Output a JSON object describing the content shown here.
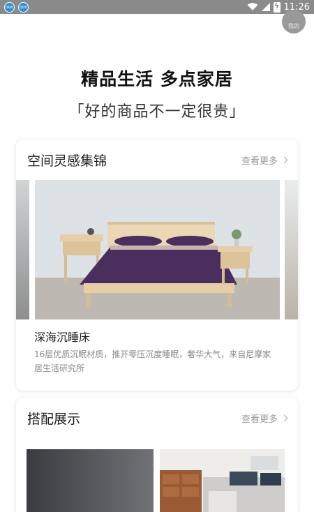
{
  "statusbar": {
    "time": "11:26",
    "apps": [
      "app-icon-1",
      "app-icon-2"
    ]
  },
  "hero": {
    "title": "精品生活 多点家居",
    "subtitle": "「好的商品不一定很贵」"
  },
  "badge": {
    "label": "我的"
  },
  "inspiration": {
    "title": "空间灵感集锦",
    "more": "查看更多",
    "product": {
      "name": "深海沉睡床",
      "desc": "16层优质沉眠材质，推开零压沉度睡眠，奢华大气，来自尼摩家居生活研究所"
    }
  },
  "showcase": {
    "title": "搭配展示",
    "more": "查看更多"
  },
  "colors": {
    "bedding": "#4a2f5e",
    "wood": "#e6cfa8",
    "status_bar": "#8a8a8a"
  }
}
